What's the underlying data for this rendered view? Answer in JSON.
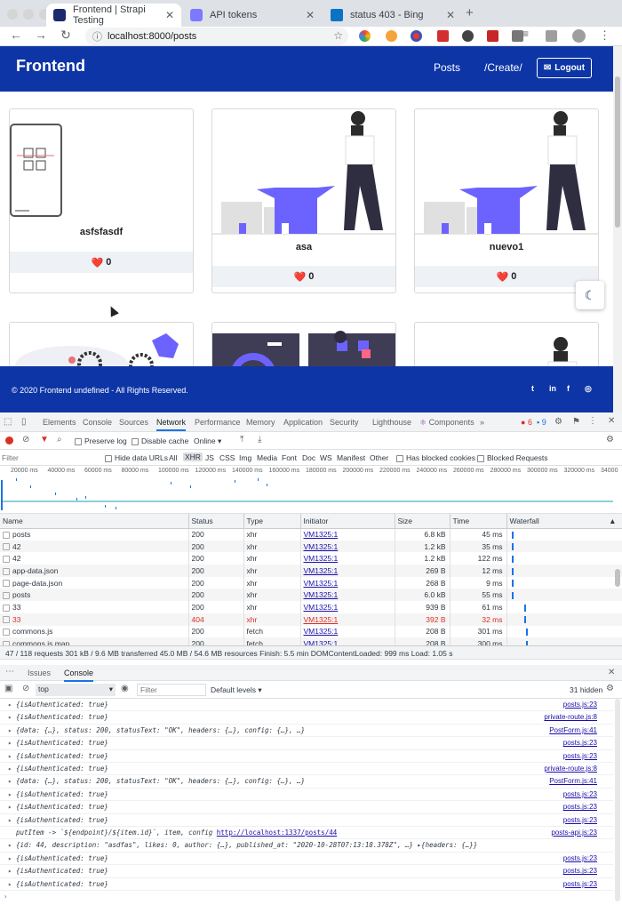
{
  "browser": {
    "tabs": [
      {
        "title": "Frontend | Strapi Testing",
        "active": true
      },
      {
        "title": "API tokens",
        "active": false
      },
      {
        "title": "status 403 - Bing",
        "active": false
      }
    ],
    "url": "localhost:8000/posts"
  },
  "site": {
    "brand": "Frontend",
    "nav": {
      "posts": "Posts",
      "create": "/Create/",
      "logout": "Logout"
    },
    "posts": [
      {
        "title": "asfsfasdf",
        "likes": "0"
      },
      {
        "title": "asa",
        "likes": "0"
      },
      {
        "title": "nuevo1",
        "likes": "0"
      }
    ],
    "footer": {
      "copyright": "© 2020 Frontend undefined - All Rights Reserved."
    },
    "heart": "❤️"
  },
  "devtools": {
    "tabs": [
      "Elements",
      "Console",
      "Sources",
      "Network",
      "Performance",
      "Memory",
      "Application",
      "Security",
      "Lighthouse",
      "Components"
    ],
    "active_tab": "Network",
    "badges": {
      "errors": "6",
      "messages": "9"
    },
    "network": {
      "preserve_log": "Preserve log",
      "disable_cache": "Disable cache",
      "throttle": "Online",
      "filter_placeholder": "Filter",
      "hide_data_urls": "Hide data URLs",
      "type_filters": [
        "All",
        "XHR",
        "JS",
        "CSS",
        "Img",
        "Media",
        "Font",
        "Doc",
        "WS",
        "Manifest",
        "Other"
      ],
      "active_type": "XHR",
      "has_blocked_cookies": "Has blocked cookies",
      "blocked_requests": "Blocked Requests",
      "timeline_ticks": [
        "20000 ms",
        "40000 ms",
        "60000 ms",
        "80000 ms",
        "100000 ms",
        "120000 ms",
        "140000 ms",
        "160000 ms",
        "180000 ms",
        "200000 ms",
        "220000 ms",
        "240000 ms",
        "260000 ms",
        "280000 ms",
        "300000 ms",
        "320000 ms",
        "34000"
      ],
      "columns": [
        "Name",
        "Status",
        "Type",
        "Initiator",
        "Size",
        "Time",
        "Waterfall"
      ],
      "rows": [
        {
          "name": "posts",
          "status": "200",
          "type": "xhr",
          "initiator": "VM1325:1",
          "size": "6.8 kB",
          "time": "45 ms",
          "error": false
        },
        {
          "name": "42",
          "status": "200",
          "type": "xhr",
          "initiator": "VM1325:1",
          "size": "1.2 kB",
          "time": "35 ms",
          "error": false
        },
        {
          "name": "42",
          "status": "200",
          "type": "xhr",
          "initiator": "VM1325:1",
          "size": "1.2 kB",
          "time": "122 ms",
          "error": false
        },
        {
          "name": "app-data.json",
          "status": "200",
          "type": "xhr",
          "initiator": "VM1325:1",
          "size": "269 B",
          "time": "12 ms",
          "error": false
        },
        {
          "name": "page-data.json",
          "status": "200",
          "type": "xhr",
          "initiator": "VM1325:1",
          "size": "268 B",
          "time": "9 ms",
          "error": false
        },
        {
          "name": "posts",
          "status": "200",
          "type": "xhr",
          "initiator": "VM1325:1",
          "size": "6.0 kB",
          "time": "55 ms",
          "error": false
        },
        {
          "name": "33",
          "status": "200",
          "type": "xhr",
          "initiator": "VM1325:1",
          "size": "939 B",
          "time": "61 ms",
          "error": false
        },
        {
          "name": "33",
          "status": "404",
          "type": "xhr",
          "initiator": "VM1325:1",
          "size": "392 B",
          "time": "32 ms",
          "error": true
        },
        {
          "name": "commons.js",
          "status": "200",
          "type": "fetch",
          "initiator": "VM1325:1",
          "size": "208 B",
          "time": "301 ms",
          "error": false
        },
        {
          "name": "commons.js.map",
          "status": "200",
          "type": "fetch",
          "initiator": "VM1325:1",
          "size": "208 B",
          "time": "300 ms",
          "error": false
        }
      ],
      "summary": "47 / 118 requests   301 kB / 9.6 MB transferred   45.0 MB / 54.6 MB resources   Finish: 5.5 min   DOMContentLoaded: 999 ms   Load: 1.05 s"
    },
    "drawer": {
      "tabs": [
        "Issues",
        "Console"
      ],
      "active": "Console",
      "context": "top",
      "filter_placeholder": "Filter",
      "levels": "Default levels ▾",
      "hidden": "31 hidden",
      "lines": [
        {
          "text": "{isAuthenticated: true}",
          "src": "posts.js:23",
          "expand": true
        },
        {
          "text": "{isAuthenticated: true}",
          "src": "private-route.js:8",
          "expand": true
        },
        {
          "text": "{data: {…}, status: 200, statusText: \"OK\", headers: {…}, config: {…}, …}",
          "src": "PostForm.js:41",
          "expand": true
        },
        {
          "text": "{isAuthenticated: true}",
          "src": "posts.js:23",
          "expand": true
        },
        {
          "text": "{isAuthenticated: true}",
          "src": "posts.js:23",
          "expand": true
        },
        {
          "text": "{isAuthenticated: true}",
          "src": "private-route.js:8",
          "expand": true
        },
        {
          "text": "{data: {…}, status: 200, statusText: \"OK\", headers: {…}, config: {…}, …}",
          "src": "PostForm.js:41",
          "expand": true
        },
        {
          "text": "{isAuthenticated: true}",
          "src": "posts.js:23",
          "expand": true
        },
        {
          "text": "{isAuthenticated: true}",
          "src": "posts.js:23",
          "expand": true
        },
        {
          "text": "{isAuthenticated: true}",
          "src": "posts.js:23",
          "expand": true
        },
        {
          "text": "putItem -> `${endpoint}/${item.id}`, item, config ",
          "link": "http://localhost:1337/posts/44",
          "src": "posts-api.js:23",
          "expand": false
        },
        {
          "text": "{id: 44, description: \"asdfas\", likes: 0, author: {…}, published_at: \"2020-10-28T07:13:18.378Z\", …} ▸{headers: {…}}",
          "src": "",
          "expand": true
        },
        {
          "text": "{isAuthenticated: true}",
          "src": "posts.js:23",
          "expand": true
        },
        {
          "text": "{isAuthenticated: true}",
          "src": "posts.js:23",
          "expand": true
        },
        {
          "text": "{isAuthenticated: true}",
          "src": "posts.js:23",
          "expand": true
        }
      ]
    }
  },
  "colors": {
    "brand_blue": "#0d35a6",
    "link": "#1a0dab",
    "error": "#d93025"
  }
}
